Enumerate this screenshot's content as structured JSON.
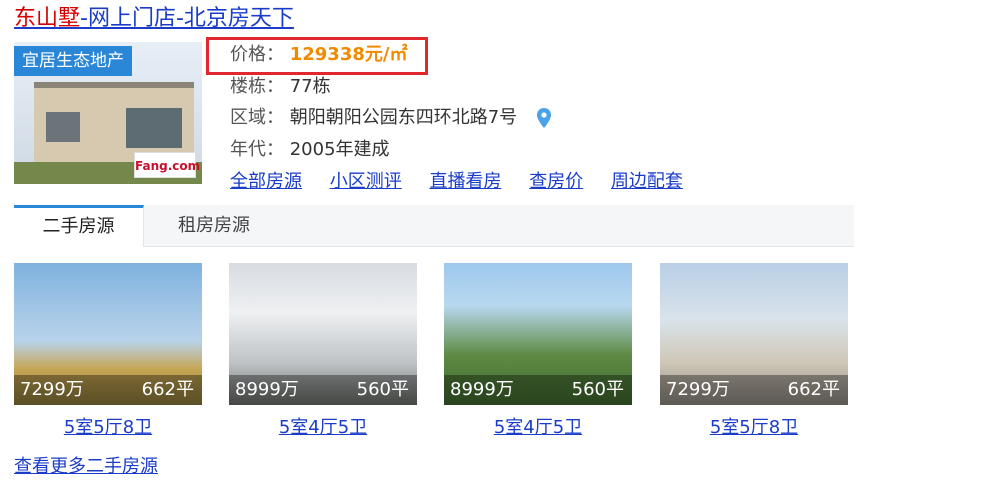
{
  "title": {
    "highlight": "东山墅",
    "rest": "-网上门店-北京房天下"
  },
  "thumb": {
    "badge": "宜居生态地产",
    "logo": "Fang.com"
  },
  "info": {
    "price_label": "价格：",
    "price_value": "129338元/㎡",
    "buildings_label": "楼栋：",
    "buildings_value": "77栋",
    "area_label": "区域：",
    "area_value": "朝阳朝阳公园东四环北路7号",
    "year_label": "年代：",
    "year_value": "2005年建成"
  },
  "links": [
    "全部房源",
    "小区测评",
    "直播看房",
    "查房价",
    "周边配套"
  ],
  "tabs": {
    "active": "二手房源",
    "inactive": "租房房源"
  },
  "listings": [
    {
      "price": "7299万",
      "area": "662平",
      "layout": "5室5厅8卫"
    },
    {
      "price": "8999万",
      "area": "560平",
      "layout": "5室4厅5卫"
    },
    {
      "price": "8999万",
      "area": "560平",
      "layout": "5室4厅5卫"
    },
    {
      "price": "7299万",
      "area": "662平",
      "layout": "5室5厅8卫"
    }
  ],
  "more_link": "查看更多二手房源",
  "colors": {
    "link": "#1a3cc8",
    "highlight": "#d40000",
    "price": "#f08a00",
    "box": "#e0282e",
    "accent": "#2a86d6"
  },
  "icons": {
    "location": "map-pin-icon"
  }
}
